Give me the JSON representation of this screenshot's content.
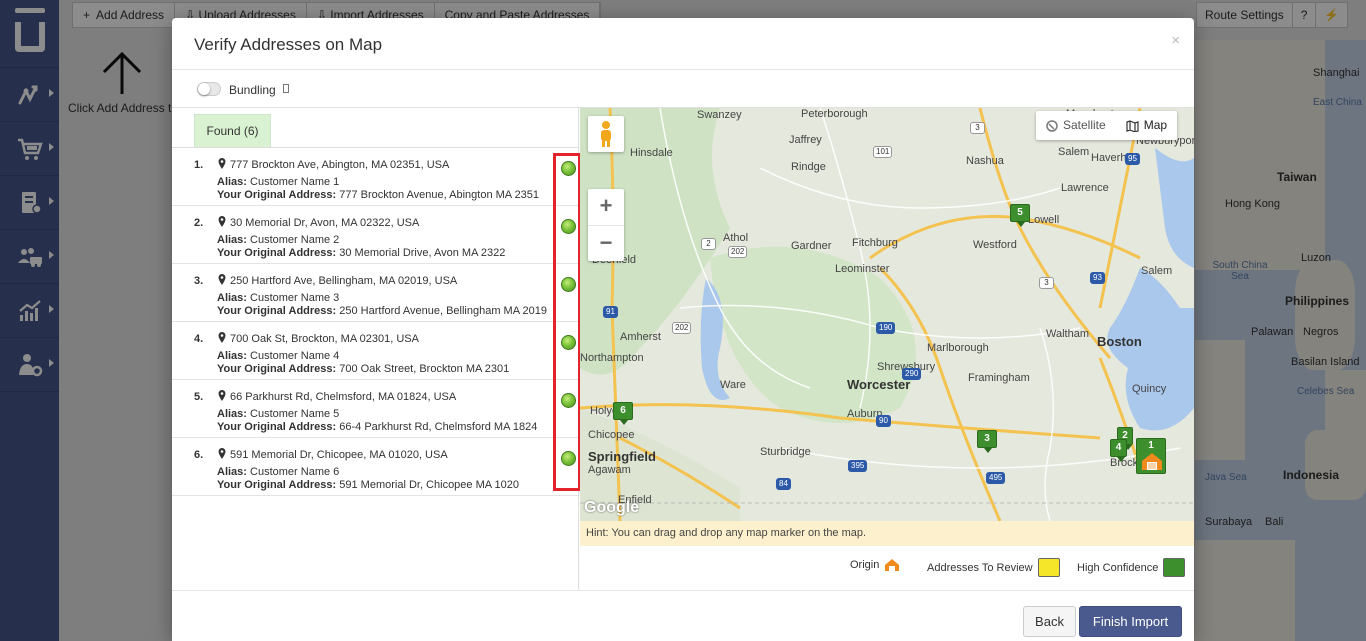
{
  "toolbar": {
    "add_address": "Add Address",
    "upload_addresses": "Upload Addresses",
    "import_addresses": "Import Addresses",
    "copy_paste": "Copy and Paste Addresses",
    "route_settings": "Route Settings",
    "help": "?",
    "lightning": "⚡"
  },
  "background": {
    "hint": "Click Add Address to",
    "map_type_satellite": "Satellite",
    "map_type_map": "Map",
    "map_labels": [
      "Shanghai",
      "East China",
      "Taiwan",
      "Hong Kong",
      "South China Sea",
      "Luzon",
      "Philippines",
      "Palawan",
      "Negros",
      "Basilan Island",
      "Celebes Sea",
      "Indonesia",
      "Java Sea",
      "Surabaya",
      "Bali"
    ]
  },
  "modal": {
    "title": "Verify Addresses on Map",
    "close": "×",
    "bundling_label": "Bundling",
    "found_tab": "Found (6)",
    "addresses": [
      {
        "num": "1.",
        "address": "777 Brockton Ave, Abington, MA 02351, USA",
        "alias_label": "Alias:",
        "alias": "Customer Name 1",
        "orig_label": "Your Original Address:",
        "orig": "777 Brockton Avenue, Abington MA 2351"
      },
      {
        "num": "2.",
        "address": "30 Memorial Dr, Avon, MA 02322, USA",
        "alias_label": "Alias:",
        "alias": "Customer Name 2",
        "orig_label": "Your Original Address:",
        "orig": "30 Memorial Drive, Avon MA 2322"
      },
      {
        "num": "3.",
        "address": "250 Hartford Ave, Bellingham, MA 02019, USA",
        "alias_label": "Alias:",
        "alias": "Customer Name 3",
        "orig_label": "Your Original Address:",
        "orig": "250 Hartford Avenue, Bellingham MA 2019"
      },
      {
        "num": "4.",
        "address": "700 Oak St, Brockton, MA 02301, USA",
        "alias_label": "Alias:",
        "alias": "Customer Name 4",
        "orig_label": "Your Original Address:",
        "orig": "700 Oak Street, Brockton MA 2301"
      },
      {
        "num": "5.",
        "address": "66 Parkhurst Rd, Chelmsford, MA 01824, USA",
        "alias_label": "Alias:",
        "alias": "Customer Name 5",
        "orig_label": "Your Original Address:",
        "orig": "66-4 Parkhurst Rd, Chelmsford MA 1824"
      },
      {
        "num": "6.",
        "address": "591 Memorial Dr, Chicopee, MA 01020, USA",
        "alias_label": "Alias:",
        "alias": "Customer Name 6",
        "orig_label": "Your Original Address:",
        "orig": "591 Memorial Dr, Chicopee MA 1020"
      }
    ],
    "map": {
      "satellite": "Satellite",
      "map": "Map",
      "zoom_in": "+",
      "zoom_out": "−",
      "google": "Google",
      "towns": [
        "Swanzey",
        "Peterborough",
        "Manchester",
        "Hinsdale",
        "Jaffrey",
        "Nashua",
        "Salem",
        "Haverhill",
        "Newburyport",
        "Rindge",
        "Lawrence",
        "Lowell",
        "Athol",
        "Gardner",
        "Fitchburg",
        "Westford",
        "Deerfield",
        "Leominster",
        "Salem",
        "Amherst",
        "Waltham",
        "Boston",
        "Northampton",
        "Marlborough",
        "Framingham",
        "Ware",
        "Worcester",
        "Shrewsbury",
        "Quincy",
        "Holyoke",
        "Auburn",
        "Chicopee",
        "Springfield",
        "Agawam",
        "Sturbridge",
        "Brockton",
        "Enfield"
      ],
      "markers": [
        "1",
        "2",
        "3",
        "4",
        "5",
        "6"
      ],
      "hint": "Hint: You can drag and drop any map marker on the map."
    },
    "legend": {
      "origin": "Origin",
      "review": "Addresses To Review",
      "high": "High Confidence",
      "colors": {
        "origin": "#f08a1c",
        "review": "#f5e62a",
        "high": "#3c8f2c"
      }
    },
    "back": "Back",
    "finish": "Finish Import"
  },
  "colors": {
    "sidebar": "#46578a",
    "status_dot": "#7cc43a",
    "highlight": "#e2232c",
    "primary_button": "#4a5a8e"
  }
}
